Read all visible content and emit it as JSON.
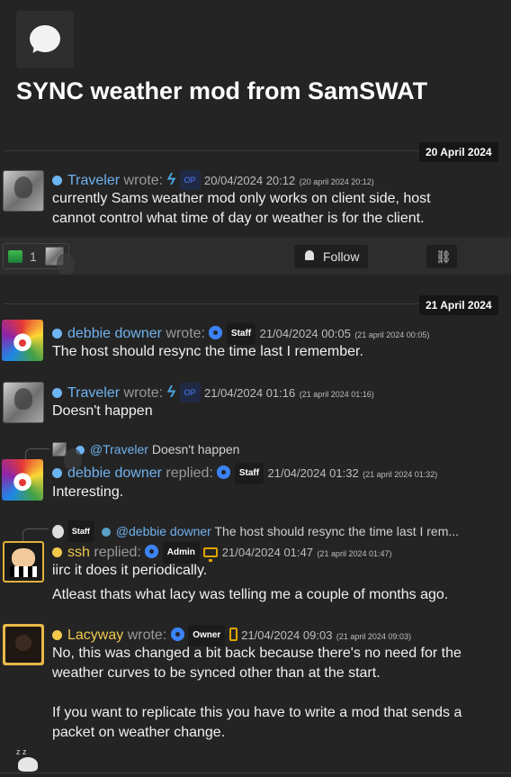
{
  "page": {
    "title": "SYNC weather mod from SamSWAT",
    "icon": "chat-bubble-icon"
  },
  "dates": [
    "20 April 2024",
    "21 April 2024"
  ],
  "actions": {
    "reaction_count": "1",
    "follow_label": "Follow",
    "link_icon": "link-icon"
  },
  "posts": [
    {
      "author": "Traveler",
      "verb": "wrote:",
      "badge": "OP",
      "timestamp": "20/04/2024 20:12",
      "timestamp_full": "(20 april 2024 20:12)",
      "text": "currently Sams weather mod only works on client side, host cannot control what time of day or weather is for the client."
    },
    {
      "author": "debbie downer",
      "verb": "wrote:",
      "badge": "Staff",
      "timestamp": "21/04/2024 00:05",
      "timestamp_full": "(21 april 2024 00:05)",
      "text": "The host should resync the time last I remember."
    },
    {
      "author": "Traveler",
      "verb": "wrote:",
      "badge": "OP",
      "timestamp": "21/04/2024 01:16",
      "timestamp_full": "(21 april 2024 01:16)",
      "text": "Doesn't happen"
    },
    {
      "reply_to_author": "@Traveler",
      "reply_to_text": "Doesn't happen",
      "author": "debbie downer",
      "verb": "replied:",
      "badge": "Staff",
      "timestamp": "21/04/2024 01:32",
      "timestamp_full": "(21 april 2024 01:32)",
      "text": "Interesting."
    },
    {
      "reply_to_badge": "Staff",
      "reply_to_author": "@debbie downer",
      "reply_to_text": "The host should resync the time last I rem...",
      "author": "ssh",
      "verb": "replied:",
      "badge": "Admin",
      "timestamp": "21/04/2024 01:47",
      "timestamp_full": "(21 april 2024 01:47)",
      "text": "iirc it does it periodically.",
      "text2": "Atleast thats what lacy was telling me a couple of months ago."
    },
    {
      "author": "Lacyway",
      "verb": "wrote:",
      "badge": "Owner",
      "timestamp": "21/04/2024 09:03",
      "timestamp_full": "(21 april 2024 09:03)",
      "text": "No, this was changed a bit back because there's no need for the weather curves to be synced other than at the start.",
      "text2": "If you want to replicate this you have to write a mod that sends a packet on weather change."
    }
  ],
  "colors": {
    "background": "#242424",
    "name_blue": "#6fb2ee",
    "name_yellow": "#f2c94c",
    "gear_blue": "#3b82f6",
    "date_badge": "#161616"
  }
}
